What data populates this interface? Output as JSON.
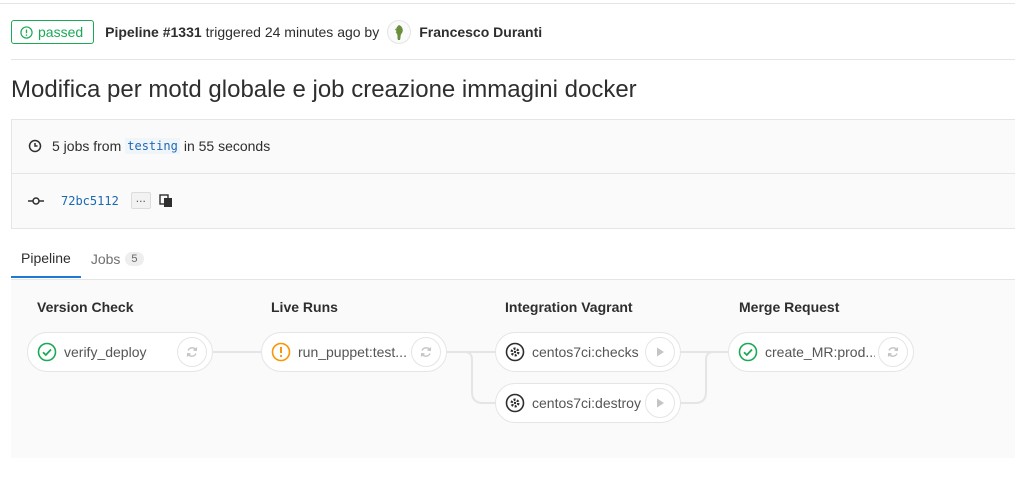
{
  "header": {
    "status_label": "passed",
    "pipeline_id": "Pipeline #1331",
    "triggered_text": "triggered 24 minutes ago by",
    "author": "Francesco Duranti"
  },
  "title": "Modifica per motd globale e job creazione immagini docker",
  "info": {
    "jobs_prefix": "5 jobs from",
    "ref": "testing",
    "duration": "in 55 seconds",
    "sha": "72bc5112",
    "ellipsis": "..."
  },
  "tabs": [
    {
      "label": "Pipeline",
      "active": true
    },
    {
      "label": "Jobs",
      "count": "5",
      "active": false
    }
  ],
  "stages": [
    {
      "name": "Version Check",
      "jobs": [
        {
          "name": "verify_deploy",
          "status": "success",
          "action": "retry"
        }
      ]
    },
    {
      "name": "Live Runs",
      "jobs": [
        {
          "name": "run_puppet:test...",
          "status": "warning",
          "action": "retry"
        }
      ]
    },
    {
      "name": "Integration Vagrant",
      "jobs": [
        {
          "name": "centos7ci:checks",
          "status": "manual",
          "action": "play"
        },
        {
          "name": "centos7ci:destroy",
          "status": "manual",
          "action": "play"
        }
      ]
    },
    {
      "name": "Merge Request",
      "jobs": [
        {
          "name": "create_MR:prod...",
          "status": "success",
          "action": "retry"
        }
      ]
    }
  ],
  "colors": {
    "success": "#1aaa55",
    "warning": "#fc9403",
    "manual": "#2e2e2e",
    "link": "#1b69b6"
  }
}
